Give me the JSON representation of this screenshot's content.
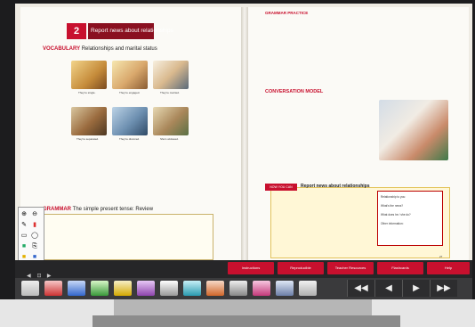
{
  "lesson": {
    "unit_number": "2",
    "title": "Report news about relationships"
  },
  "vocabulary": {
    "title": "VOCABULARY",
    "subtitle": "Relationships and marital status",
    "captions": [
      "They're single.",
      "They're engaged.",
      "They're married.",
      "They're separated.",
      "They're divorced.",
      "She's widowed."
    ]
  },
  "grammar_practice": {
    "title": "GRAMMAR PRACTICE"
  },
  "grammar": {
    "title": "GRAMMAR",
    "subtitle": "The simple present tense: Review"
  },
  "conversation": {
    "title": "CONVERSATION MODEL"
  },
  "now_you_can": {
    "tab": "NOW YOU CAN",
    "title": "Report news about relationships",
    "notes": [
      "Relationship to you:",
      "What's the news?",
      "What does he / she do?",
      "Other information:"
    ]
  },
  "pages": {
    "left_number": "26",
    "right_number": "27"
  },
  "toolbar": {
    "buttons": [
      "Instructions",
      "Reproducible",
      "Teacher Resources",
      "Flashcards",
      "Help"
    ],
    "nav": [
      "◀◀",
      "◀",
      "▶",
      "▶▶"
    ]
  },
  "palette": {
    "icons": [
      "zoom-in-icon",
      "zoom-out-icon",
      "pen-icon",
      "highlighter-icon",
      "eraser-icon",
      "shape-icon",
      "color-icon",
      "link-icon"
    ]
  },
  "colors": {
    "accent": "#c8102e",
    "toolbar": "#262628",
    "note_bg": "#fff7d6"
  }
}
